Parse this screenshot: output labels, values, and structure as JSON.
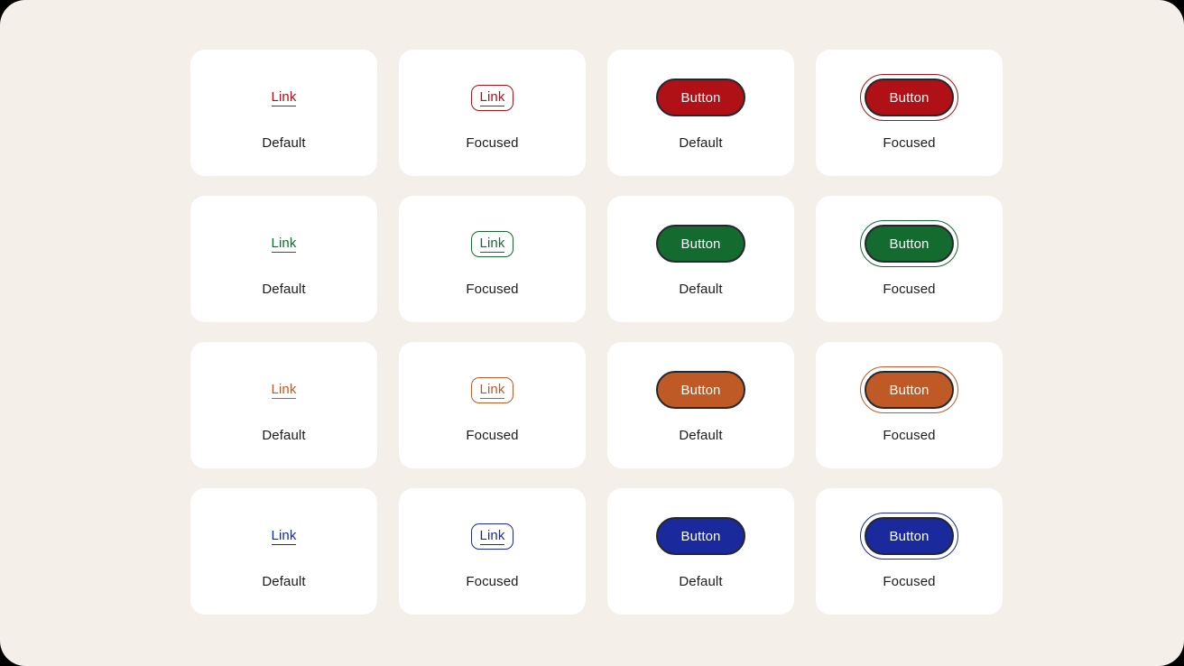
{
  "page": {
    "background_color": "#F4EFE9",
    "outer_color": "#000000",
    "card_color": "#FFFFFF",
    "caption_color": "#1C1C1C",
    "button_border_color": "#25282B",
    "button_text_color": "#FFFFFF"
  },
  "labels": {
    "default": "Default",
    "focused": "Focused",
    "link": "Link",
    "button": "Button"
  },
  "themes": [
    {
      "name": "red",
      "color": "#B01116"
    },
    {
      "name": "green",
      "color": "#136B30"
    },
    {
      "name": "orange",
      "color": "#BF5A26"
    },
    {
      "name": "blue",
      "color": "#1A2A9C"
    }
  ],
  "cells": [
    {
      "row": 0,
      "theme": "red",
      "color": "#B01116",
      "kind": "link",
      "state": "default",
      "control_label": "Link",
      "caption": "Default"
    },
    {
      "row": 0,
      "theme": "red",
      "color": "#B01116",
      "kind": "link",
      "state": "focused",
      "control_label": "Link",
      "caption": "Focused"
    },
    {
      "row": 0,
      "theme": "red",
      "color": "#B01116",
      "kind": "button",
      "state": "default",
      "control_label": "Button",
      "caption": "Default"
    },
    {
      "row": 0,
      "theme": "red",
      "color": "#B01116",
      "kind": "button",
      "state": "focused",
      "control_label": "Button",
      "caption": "Focused"
    },
    {
      "row": 1,
      "theme": "green",
      "color": "#136B30",
      "kind": "link",
      "state": "default",
      "control_label": "Link",
      "caption": "Default"
    },
    {
      "row": 1,
      "theme": "green",
      "color": "#136B30",
      "kind": "link",
      "state": "focused",
      "control_label": "Link",
      "caption": "Focused"
    },
    {
      "row": 1,
      "theme": "green",
      "color": "#136B30",
      "kind": "button",
      "state": "default",
      "control_label": "Button",
      "caption": "Default"
    },
    {
      "row": 1,
      "theme": "green",
      "color": "#136B30",
      "kind": "button",
      "state": "focused",
      "control_label": "Button",
      "caption": "Focused"
    },
    {
      "row": 2,
      "theme": "orange",
      "color": "#BF5A26",
      "kind": "link",
      "state": "default",
      "control_label": "Link",
      "caption": "Default"
    },
    {
      "row": 2,
      "theme": "orange",
      "color": "#BF5A26",
      "kind": "link",
      "state": "focused",
      "control_label": "Link",
      "caption": "Focused"
    },
    {
      "row": 2,
      "theme": "orange",
      "color": "#BF5A26",
      "kind": "button",
      "state": "default",
      "control_label": "Button",
      "caption": "Default"
    },
    {
      "row": 2,
      "theme": "orange",
      "color": "#BF5A26",
      "kind": "button",
      "state": "focused",
      "control_label": "Button",
      "caption": "Focused"
    },
    {
      "row": 3,
      "theme": "blue",
      "color": "#1A2A9C",
      "kind": "link",
      "state": "default",
      "control_label": "Link",
      "caption": "Default"
    },
    {
      "row": 3,
      "theme": "blue",
      "color": "#1A2A9C",
      "kind": "link",
      "state": "focused",
      "control_label": "Link",
      "caption": "Focused"
    },
    {
      "row": 3,
      "theme": "blue",
      "color": "#1A2A9C",
      "kind": "button",
      "state": "default",
      "control_label": "Button",
      "caption": "Default"
    },
    {
      "row": 3,
      "theme": "blue",
      "color": "#1A2A9C",
      "kind": "button",
      "state": "focused",
      "control_label": "Button",
      "caption": "Focused"
    }
  ]
}
